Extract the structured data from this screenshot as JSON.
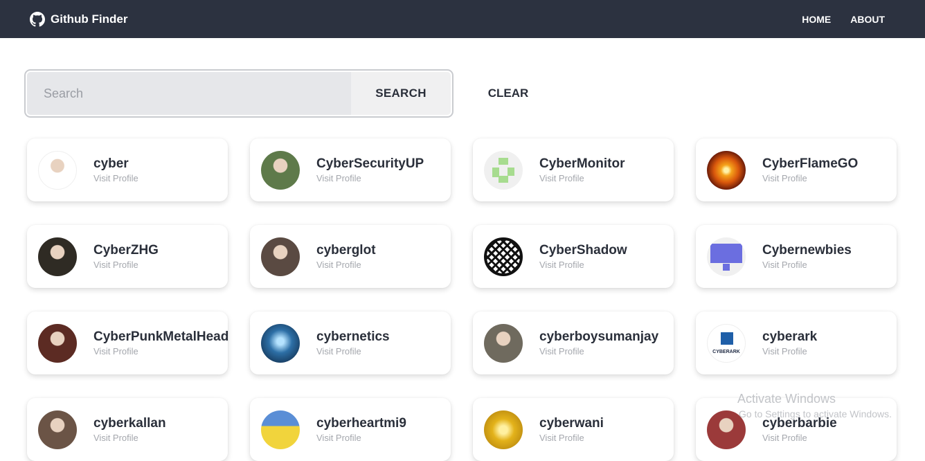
{
  "navbar": {
    "brand_title": "Github Finder",
    "brand_icon": "github-icon",
    "links": [
      {
        "label": "HOME"
      },
      {
        "label": "ABOUT"
      }
    ]
  },
  "search": {
    "placeholder": "Search",
    "value": "",
    "search_label": "SEARCH",
    "clear_label": "CLEAR"
  },
  "users": [
    {
      "login": "cyber",
      "link_label": "Visit Profile",
      "avatar": "blank-avatar",
      "avatar_color": "#ffffff"
    },
    {
      "login": "CyberSecurityUP",
      "link_label": "Visit Profile",
      "avatar": "anime-boy-avatar",
      "avatar_color": "#5e7a4a"
    },
    {
      "login": "CyberMonitor",
      "link_label": "Visit Profile",
      "avatar": "identicon-green-avatar",
      "avatar_color": "#a7dc8f"
    },
    {
      "login": "CyberFlameGO",
      "link_label": "Visit Profile",
      "avatar": "flame-spiral-avatar",
      "avatar_color": "#d9570c"
    },
    {
      "login": "CyberZHG",
      "link_label": "Visit Profile",
      "avatar": "photo-avatar",
      "avatar_color": "#2f2b24"
    },
    {
      "login": "cyberglot",
      "link_label": "Visit Profile",
      "avatar": "portrait-avatar",
      "avatar_color": "#5a4a42"
    },
    {
      "login": "CyberShadow",
      "link_label": "Visit Profile",
      "avatar": "maze-symbol-avatar",
      "avatar_color": "#111111"
    },
    {
      "login": "Cybernewbies",
      "link_label": "Visit Profile",
      "avatar": "identicon-purple-avatar",
      "avatar_color": "#6b6ee0"
    },
    {
      "login": "CyberPunkMetalHead",
      "link_label": "Visit Profile",
      "avatar": "samurai-mask-avatar",
      "avatar_color": "#5c2b23"
    },
    {
      "login": "cybernetics",
      "link_label": "Visit Profile",
      "avatar": "blue-brain-avatar",
      "avatar_color": "#2d6fa6"
    },
    {
      "login": "cyberboysumanjay",
      "link_label": "Visit Profile",
      "avatar": "outdoor-photo-avatar",
      "avatar_color": "#6f6a5e"
    },
    {
      "login": "cyberark",
      "link_label": "Visit Profile",
      "avatar": "cyberark-logo-avatar",
      "avatar_color": "#1f5fa8",
      "avatar_text": "CYBERARK"
    },
    {
      "login": "cyberkallan",
      "link_label": "Visit Profile",
      "avatar": "face-photo-avatar",
      "avatar_color": "#6b5446"
    },
    {
      "login": "cyberheartmi9",
      "link_label": "Visit Profile",
      "avatar": "pikachu-avatar",
      "avatar_color": "#f1d43c"
    },
    {
      "login": "cyberwani",
      "link_label": "Visit Profile",
      "avatar": "gold-coin-avatar",
      "avatar_color": "#e3b21a"
    },
    {
      "login": "cyberbarbie",
      "link_label": "Visit Profile",
      "avatar": "red-portrait-avatar",
      "avatar_color": "#9b3a3a"
    }
  ],
  "watermark": {
    "title": "Activate Windows",
    "subtitle": "Go to Settings to activate Windows."
  }
}
